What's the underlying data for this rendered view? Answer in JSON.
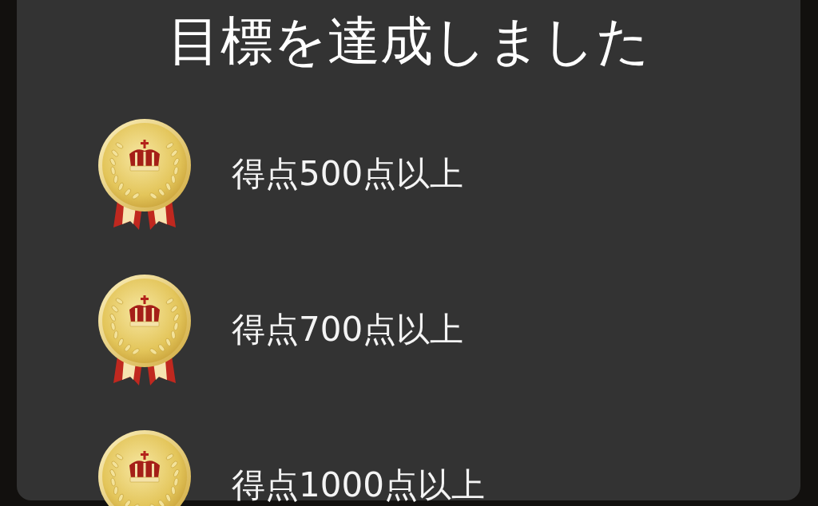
{
  "dialog": {
    "title": "目標を達成しました",
    "goals": [
      {
        "label": "得点500点以上"
      },
      {
        "label": "得点700点以上"
      },
      {
        "label": "得点1000点以上"
      }
    ]
  }
}
